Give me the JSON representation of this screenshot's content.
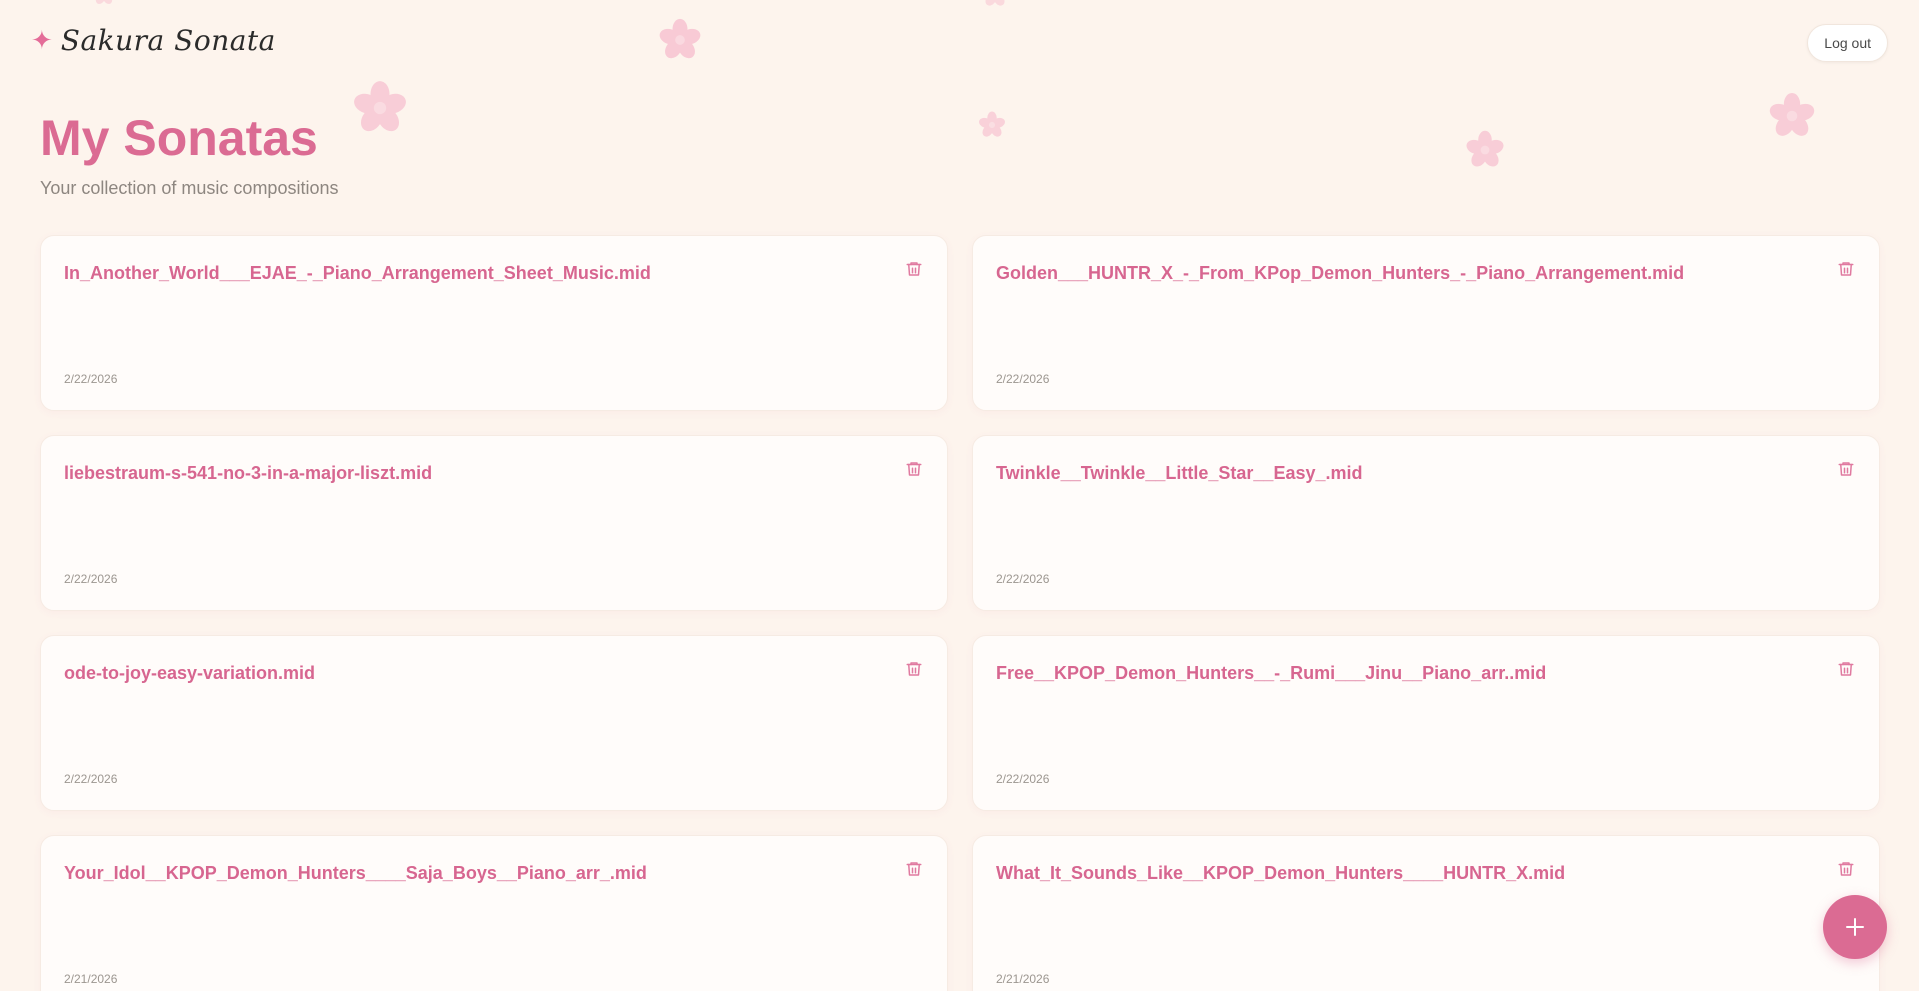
{
  "app": {
    "brand_name": "Sakura Sonata",
    "brand_icon": "sparkle-icon"
  },
  "header": {
    "logout_label": "Log out"
  },
  "main": {
    "title": "My Sonatas",
    "subtitle": "Your collection of music compositions"
  },
  "sonatas": [
    {
      "title": "In_Another_World___EJAE_-_Piano_Arrangement_Sheet_Music.mid",
      "date": "2/22/2026"
    },
    {
      "title": "Golden___HUNTR_X_-_From_KPop_Demon_Hunters_-_Piano_Arrangement.mid",
      "date": "2/22/2026"
    },
    {
      "title": "liebestraum-s-541-no-3-in-a-major-liszt.mid",
      "date": "2/22/2026"
    },
    {
      "title": "Twinkle__Twinkle__Little_Star__Easy_.mid",
      "date": "2/22/2026"
    },
    {
      "title": "ode-to-joy-easy-variation.mid",
      "date": "2/22/2026"
    },
    {
      "title": "Free__KPOP_Demon_Hunters__-_Rumi___Jinu__Piano_arr..mid",
      "date": "2/22/2026"
    },
    {
      "title": "Your_Idol__KPOP_Demon_Hunters____Saja_Boys__Piano_arr_.mid",
      "date": "2/21/2026"
    },
    {
      "title": "What_It_Sounds_Like__KPOP_Demon_Hunters____HUNTR_X.mid",
      "date": "2/21/2026"
    }
  ],
  "icons": {
    "delete": "trash-icon",
    "add": "plus-icon",
    "decor": "sakura-flower-icon"
  },
  "colors": {
    "background": "#fdf4ed",
    "accent": "#db6b93",
    "card": "#fffcfa",
    "muted_text": "#8d8680"
  }
}
